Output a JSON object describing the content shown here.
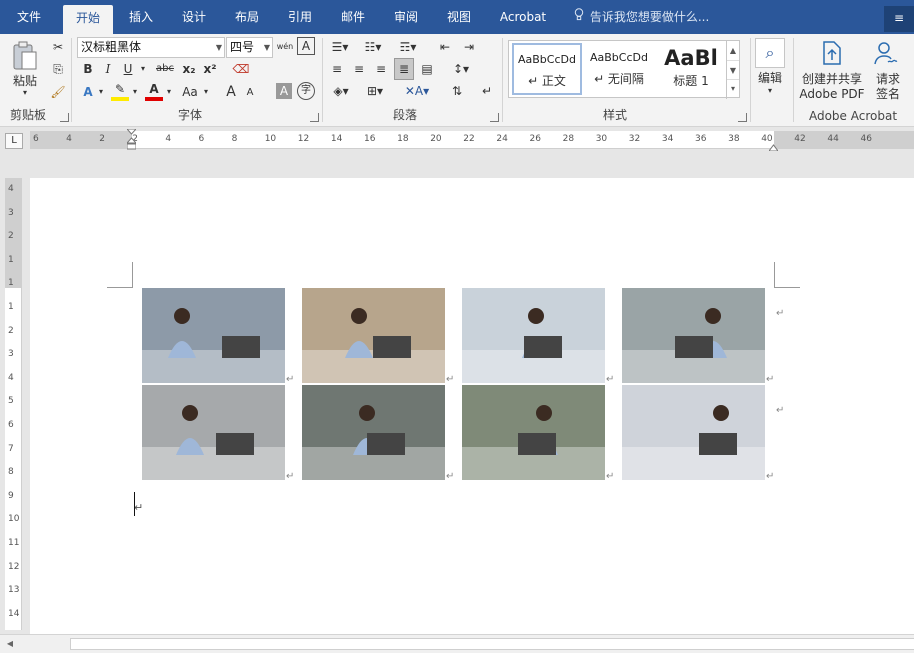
{
  "tabs": [
    {
      "label": "文件",
      "active": false
    },
    {
      "label": "开始",
      "active": true
    },
    {
      "label": "插入",
      "active": false
    },
    {
      "label": "设计",
      "active": false
    },
    {
      "label": "布局",
      "active": false
    },
    {
      "label": "引用",
      "active": false
    },
    {
      "label": "邮件",
      "active": false
    },
    {
      "label": "审阅",
      "active": false
    },
    {
      "label": "视图",
      "active": false
    },
    {
      "label": "Acrobat",
      "active": false
    }
  ],
  "tell_me": "告诉我您想要做什么...",
  "user_initial": "≡",
  "clipboard": {
    "paste_label": "粘贴",
    "group_label": "剪贴板"
  },
  "font": {
    "name": "汉标粗黑体",
    "size": "四号",
    "bold": "B",
    "italic": "I",
    "underline": "U",
    "strike": "abc",
    "subscript": "x₂",
    "superscript": "x²",
    "change_case": "Aa",
    "grow": "A",
    "shrink": "A",
    "wen": "wén",
    "group_label": "字体"
  },
  "paragraph": {
    "group_label": "段落"
  },
  "styles": {
    "items": [
      {
        "sample": "AaBbCcDd",
        "name": "↵ 正文"
      },
      {
        "sample": "AaBbCcDd",
        "name": "↵ 无间隔"
      },
      {
        "sample": "AaBl",
        "name": "标题 1"
      }
    ],
    "group_label": "样式"
  },
  "editing": {
    "label": "编辑"
  },
  "acrobat": {
    "create_line1": "创建并共享",
    "create_line2": "Adobe PDF",
    "sign_line1": "请求",
    "sign_line2": "签名",
    "group_label": "Adobe Acrobat"
  },
  "ruler": {
    "tab_selector": "L",
    "h_numbers": [
      "6",
      "4",
      "2",
      "2",
      "4",
      "6",
      "8",
      "10",
      "12",
      "14",
      "16",
      "18",
      "20",
      "22",
      "24",
      "26",
      "28",
      "30",
      "32",
      "34",
      "36",
      "38",
      "40",
      "42",
      "44",
      "46"
    ],
    "v_numbers": [
      "4",
      "3",
      "2",
      "1",
      "1",
      "1",
      "2",
      "3",
      "4",
      "5",
      "6",
      "7",
      "8",
      "9",
      "10",
      "11",
      "12",
      "13",
      "14"
    ]
  },
  "document": {
    "photos": [
      {
        "name": "technicians-repairing-laptop",
        "bg": "#8d9aa8"
      },
      {
        "name": "engineer-working-laptop-desk",
        "bg": "#b7a58c"
      },
      {
        "name": "technicians-display-screen",
        "bg": "#c9d2da"
      },
      {
        "name": "technicians-inspecting-machine",
        "bg": "#9aa4a6"
      },
      {
        "name": "technicians-servicing-copier",
        "bg": "#a6a9ab"
      },
      {
        "name": "team-working-office-computers",
        "bg": "#6f7772"
      },
      {
        "name": "engineer-assisting-customer",
        "bg": "#7f8a78"
      },
      {
        "name": "engineer-presentation-screen",
        "bg": "#cfd3da"
      }
    ],
    "para_mark": "↵"
  }
}
